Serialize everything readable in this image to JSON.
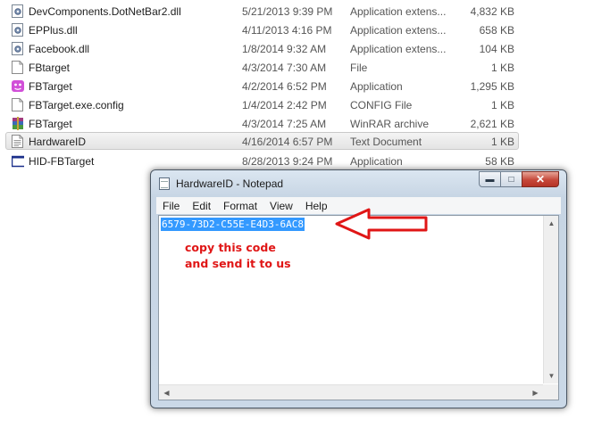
{
  "files": [
    {
      "name": "DevComponents.DotNetBar2.dll",
      "date": "5/21/2013 9:39 PM",
      "type": "Application extens...",
      "size": "4,832 KB",
      "icon": "dll-icon"
    },
    {
      "name": "EPPlus.dll",
      "date": "4/11/2013 4:16 PM",
      "type": "Application extens...",
      "size": "658 KB",
      "icon": "dll-icon"
    },
    {
      "name": "Facebook.dll",
      "date": "1/8/2014 9:32 AM",
      "type": "Application extens...",
      "size": "104 KB",
      "icon": "dll-icon"
    },
    {
      "name": "FBtarget",
      "date": "4/3/2014 7:30 AM",
      "type": "File",
      "size": "1 KB",
      "icon": "blank-file-icon"
    },
    {
      "name": "FBTarget",
      "date": "4/2/2014 6:52 PM",
      "type": "Application",
      "size": "1,295 KB",
      "icon": "app-pink-icon"
    },
    {
      "name": "FBTarget.exe.config",
      "date": "1/4/2014 2:42 PM",
      "type": "CONFIG File",
      "size": "1 KB",
      "icon": "config-file-icon"
    },
    {
      "name": "FBTarget",
      "date": "4/3/2014 7:25 AM",
      "type": "WinRAR archive",
      "size": "2,621 KB",
      "icon": "winrar-icon"
    },
    {
      "name": "HardwareID",
      "date": "4/16/2014 6:57 PM",
      "type": "Text Document",
      "size": "1 KB",
      "icon": "text-file-icon"
    },
    {
      "name": "HID-FBTarget",
      "date": "8/28/2013 9:24 PM",
      "type": "Application",
      "size": "58 KB",
      "icon": "app-window-icon"
    }
  ],
  "selected_file": "HardwareID",
  "notepad": {
    "title": "HardwareID - Notepad",
    "menu": [
      "File",
      "Edit",
      "Format",
      "View",
      "Help"
    ],
    "content": "6579-73D2-C55E-E4D3-6AC8",
    "buttons": {
      "minimize": "▬",
      "maximize": "□",
      "close": "✕"
    }
  },
  "annotation": {
    "line1": "copy this code",
    "line2": "and send it to us",
    "color": "#e01616"
  },
  "colors": {
    "selection": "#3399ff",
    "annotation_red": "#e01616"
  }
}
